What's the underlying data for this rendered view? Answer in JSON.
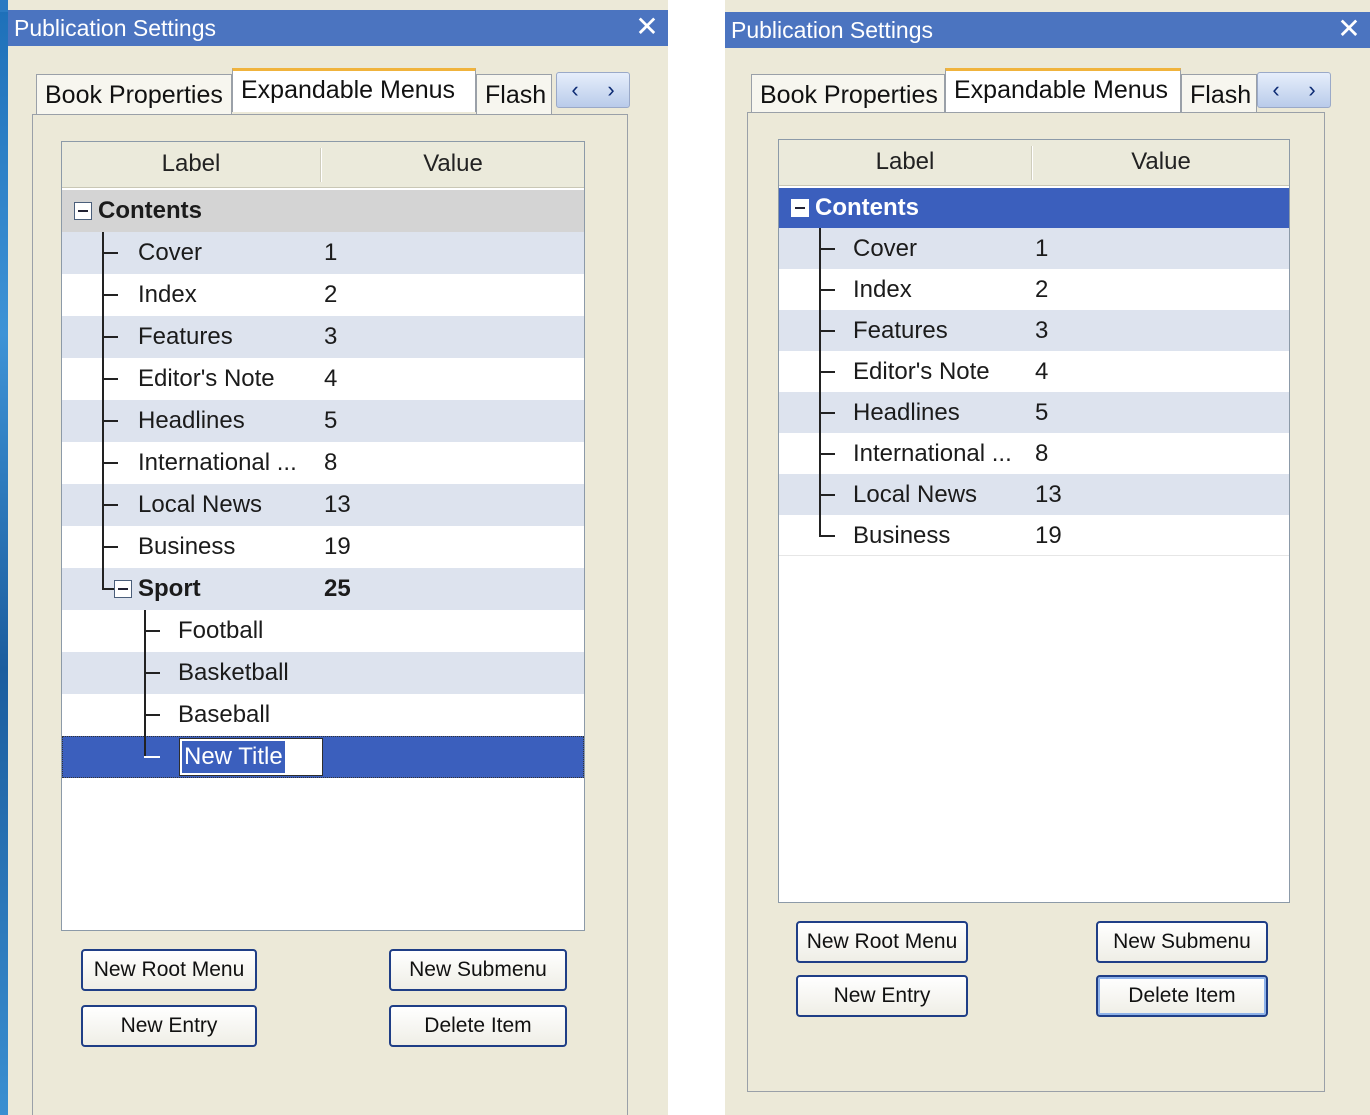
{
  "windows": [
    {
      "title": "Publication Settings",
      "close_glyph": "✕",
      "tabs": [
        "Book Properties",
        "Expandable Menus",
        "Flash"
      ],
      "active_tab": "Expandable Menus",
      "scroll_left_glyph": "‹",
      "scroll_right_glyph": "›",
      "columns": [
        "Label",
        "Value"
      ],
      "root": {
        "label": "Contents",
        "expanded": true,
        "selected": false
      },
      "items": [
        {
          "label": "Cover",
          "value": "1"
        },
        {
          "label": "Index",
          "value": "2"
        },
        {
          "label": "Features",
          "value": "3"
        },
        {
          "label": "Editor's Note",
          "value": "4"
        },
        {
          "label": "Headlines",
          "value": "5"
        },
        {
          "label": "International ...",
          "value": "8"
        },
        {
          "label": "Local News",
          "value": "13"
        },
        {
          "label": "Business",
          "value": "19"
        }
      ],
      "subgroup": {
        "label": "Sport",
        "value": "25",
        "expanded": true,
        "children": [
          "Football",
          "Basketball",
          "Baseball"
        ],
        "editing_value": "New Title"
      },
      "buttons": {
        "new_root_menu": "New Root Menu",
        "new_submenu": "New Submenu",
        "new_entry": "New Entry",
        "delete_item": "Delete Item"
      }
    },
    {
      "title": "Publication Settings",
      "close_glyph": "✕",
      "tabs": [
        "Book Properties",
        "Expandable Menus",
        "Flash"
      ],
      "active_tab": "Expandable Menus",
      "scroll_left_glyph": "‹",
      "scroll_right_glyph": "›",
      "columns": [
        "Label",
        "Value"
      ],
      "root": {
        "label": "Contents",
        "expanded": true,
        "selected": true
      },
      "items": [
        {
          "label": "Cover",
          "value": "1"
        },
        {
          "label": "Index",
          "value": "2"
        },
        {
          "label": "Features",
          "value": "3"
        },
        {
          "label": "Editor's Note",
          "value": "4"
        },
        {
          "label": "Headlines",
          "value": "5"
        },
        {
          "label": "International ...",
          "value": "8"
        },
        {
          "label": "Local News",
          "value": "13"
        },
        {
          "label": "Business",
          "value": "19"
        }
      ],
      "buttons": {
        "new_root_menu": "New Root Menu",
        "new_submenu": "New Submenu",
        "new_entry": "New Entry",
        "delete_item": "Delete Item"
      }
    }
  ],
  "colors": {
    "titlebar": "#4b74c0",
    "selection": "#3b5fbd",
    "row_alt": "#dde3ee",
    "window_bg": "#ece9d8",
    "active_tab_accent": "#f0b33c"
  },
  "icons": {
    "close": "close-icon",
    "expander": "collapse-minus-icon",
    "tab_scroll_left": "chevron-left-icon",
    "tab_scroll_right": "chevron-right-icon"
  }
}
